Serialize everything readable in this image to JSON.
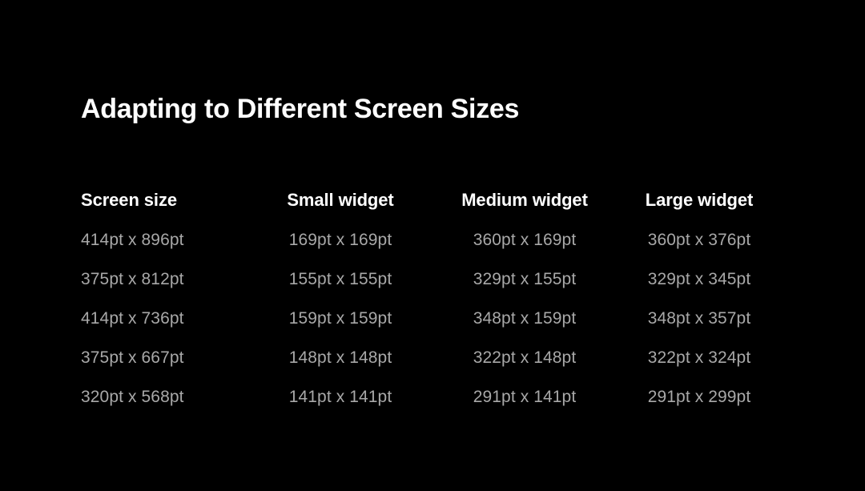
{
  "slide": {
    "title": "Adapting to Different Screen Sizes",
    "background_color": "#000000",
    "title_color": "#ffffff",
    "body_text_color": "#a8a8a8"
  },
  "table": {
    "headers": [
      "Screen size",
      "Small widget",
      "Medium widget",
      "Large widget"
    ],
    "rows": [
      [
        "414pt x 896pt",
        "169pt x 169pt",
        "360pt x 169pt",
        "360pt x 376pt"
      ],
      [
        "375pt x 812pt",
        "155pt x 155pt",
        "329pt x 155pt",
        "329pt x 345pt"
      ],
      [
        "414pt x 736pt",
        "159pt x 159pt",
        "348pt x 159pt",
        "348pt x 357pt"
      ],
      [
        "375pt x 667pt",
        "148pt x 148pt",
        "322pt x 148pt",
        "322pt x 324pt"
      ],
      [
        "320pt x 568pt",
        "141pt x 141pt",
        "291pt x 141pt",
        "291pt x 299pt"
      ]
    ]
  }
}
